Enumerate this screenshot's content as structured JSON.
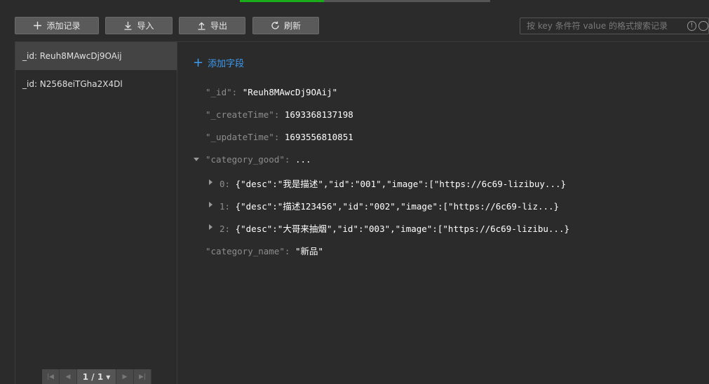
{
  "toolbar": {
    "add_label": "添加记录",
    "import_label": "导入",
    "export_label": "导出",
    "refresh_label": "刷新"
  },
  "search": {
    "placeholder": "按 key 条件符 value 的格式搜索记录"
  },
  "records": [
    {
      "label": "_id: Reuh8MAwcDj9OAij"
    },
    {
      "label": "_id: N2568eiTGha2X4Dl"
    }
  ],
  "pager": {
    "page": "1 / 1"
  },
  "detail": {
    "add_field_label": "添加字段",
    "fields": {
      "id_key": "\"_id\"",
      "id_val": "\"Reuh8MAwcDj9OAij\"",
      "create_key": "\"_createTime\"",
      "create_val": "1693368137198",
      "update_key": "\"_updateTime\"",
      "update_val": "1693556810851",
      "cat_good_key": "\"category_good\"",
      "cat_good_val": "...",
      "items": [
        {
          "index": "0:",
          "value": "{\"desc\":\"我是描述\",\"id\":\"001\",\"image\":[\"https://6c69-lizibuy...}"
        },
        {
          "index": "1:",
          "value": "{\"desc\":\"描述123456\",\"id\":\"002\",\"image\":[\"https://6c69-liz...}"
        },
        {
          "index": "2:",
          "value": "{\"desc\":\"大哥来抽烟\",\"id\":\"003\",\"image\":[\"https://6c69-lizibu...}"
        }
      ],
      "cat_name_key": "\"category_name\"",
      "cat_name_val": "\"新品\""
    }
  },
  "colors": {
    "accent": "#1aad19",
    "link": "#3d9bf0"
  }
}
